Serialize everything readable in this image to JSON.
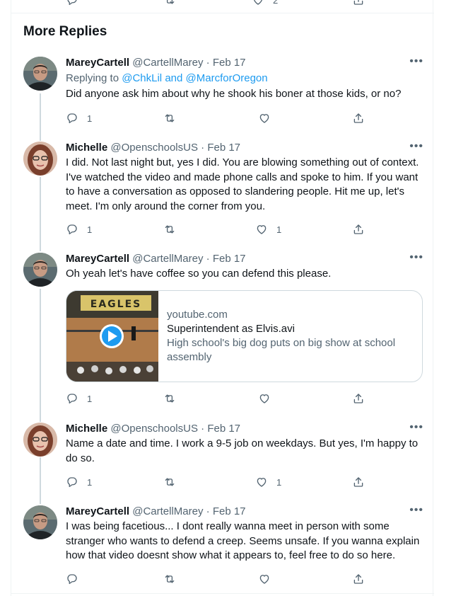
{
  "top_stub": {
    "like_count": "2"
  },
  "section": {
    "title": "More Replies"
  },
  "tweets": [
    {
      "name": "MareyCartell",
      "handle": "@CartellMarey",
      "sep": "·",
      "date": "Feb 17",
      "reply_prefix": "Replying to",
      "reply_user1": "@ChkLil",
      "reply_and": "and",
      "reply_user2": "@MarcforOregon",
      "text": "Did anyone ask him about why he shook his boner at those kids, or no?",
      "reply_count": "1",
      "retweet_count": "",
      "like_count": ""
    },
    {
      "name": "Michelle",
      "handle": "@OpenschoolsUS",
      "sep": "·",
      "date": "Feb 17",
      "text": "I did. Not last night but, yes I did. You are blowing something out of context. I've watched the video and made phone calls and spoke to him.   If you want to have a conversation as opposed to slandering people. Hit me up, let's meet. I'm only around the corner from you.",
      "reply_count": "1",
      "retweet_count": "",
      "like_count": "1"
    },
    {
      "name": "MareyCartell",
      "handle": "@CartellMarey",
      "sep": "·",
      "date": "Feb 17",
      "text": "Oh yeah let's have coffee so you can defend this please.",
      "card": {
        "domain": "youtube.com",
        "title": "Superintendent as Elvis.avi",
        "description": "High school's big dog puts on big show at school assembly",
        "thumb_banner": "EAGLES"
      },
      "reply_count": "1",
      "retweet_count": "",
      "like_count": ""
    },
    {
      "name": "Michelle",
      "handle": "@OpenschoolsUS",
      "sep": "·",
      "date": "Feb 17",
      "text": "Name a date and time. I work a 9-5 job on weekdays.  But yes, I'm happy to do so.",
      "reply_count": "1",
      "retweet_count": "",
      "like_count": "1"
    },
    {
      "name": "MareyCartell",
      "handle": "@CartellMarey",
      "sep": "·",
      "date": "Feb 17",
      "text": "I was being facetious... I dont really wanna meet in person with some stranger who wants to defend a creep. Seems unsafe. If you wanna explain how that video doesnt show what it appears to, feel free to do so here.",
      "reply_count": "",
      "retweet_count": "",
      "like_count": ""
    }
  ],
  "icons": {
    "more": "more-icon",
    "reply": "reply-icon",
    "retweet": "retweet-icon",
    "like": "like-icon",
    "share": "share-icon",
    "play": "play-icon"
  },
  "colors": {
    "link": "#1d9bf0",
    "muted": "#536471",
    "text": "#0f1419",
    "border": "#eff3f4",
    "thread_line": "#cfd9de",
    "play_button": "#1d9bf0"
  }
}
